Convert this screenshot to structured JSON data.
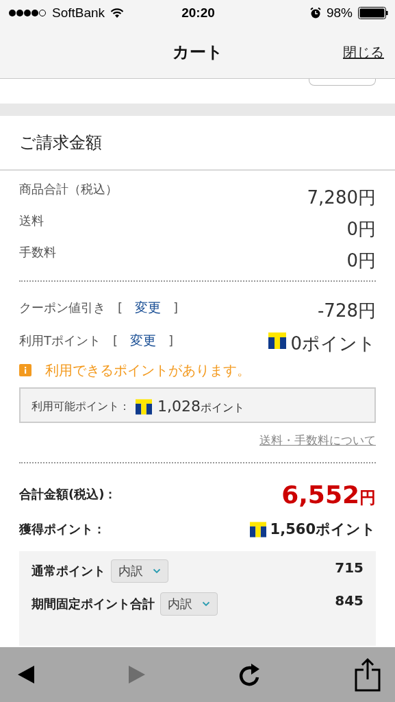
{
  "status_bar": {
    "carrier": "SoftBank",
    "time": "20:20",
    "battery": "98%"
  },
  "nav": {
    "title": "カート",
    "close": "閉じる"
  },
  "section": {
    "title": "ご請求金額"
  },
  "charges": [
    {
      "label": "商品合計（税込）",
      "value": "7,280円"
    },
    {
      "label": "送料",
      "value": "0円"
    },
    {
      "label": "手数料",
      "value": "0円"
    }
  ],
  "discounts": [
    {
      "label": "クーポン値引き",
      "open": "[",
      "link": "変更",
      "close": "]",
      "value": "-728円",
      "kind": "yen"
    },
    {
      "label": "利用Tポイント",
      "open": "[",
      "link": "変更",
      "close": "]",
      "value": "0ポイント",
      "kind": "points"
    }
  ],
  "notice": "利用できるポイントがあります。",
  "available": {
    "label": "利用可能ポイント：",
    "amount": "1,028",
    "unit": "ポイント"
  },
  "fees_link": "送料・手数料について",
  "total": {
    "label": "合計金額(税込)：",
    "amount": "6,552",
    "unit": "円"
  },
  "earned": {
    "label": "獲得ポイント：",
    "value": "1,560ポイント"
  },
  "breakdown": [
    {
      "label": "通常ポイント",
      "button": "内訳",
      "value": "715"
    },
    {
      "label": "期間固定ポイント合計",
      "button": "内訳",
      "value": "845"
    }
  ],
  "toolbar": [
    {
      "kind": "back",
      "disabled": false
    },
    {
      "kind": "forward",
      "disabled": true
    },
    {
      "kind": "reload",
      "disabled": false
    },
    {
      "kind": "share",
      "disabled": false
    }
  ]
}
